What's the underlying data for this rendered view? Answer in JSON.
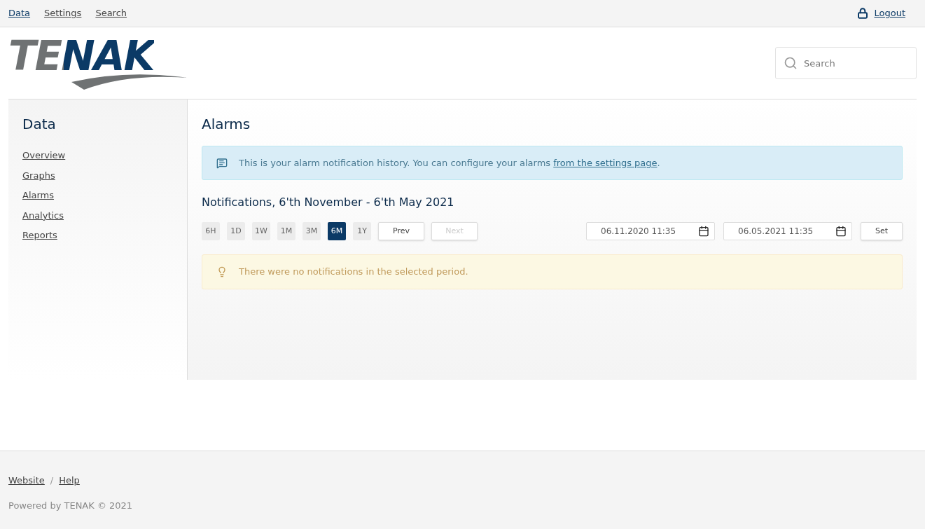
{
  "top_nav": {
    "links": [
      {
        "label": "Data",
        "selected": true
      },
      {
        "label": "Settings",
        "selected": false
      },
      {
        "label": "Search",
        "selected": false
      }
    ],
    "logout": "Logout"
  },
  "logo": {
    "text": "TENAK"
  },
  "search": {
    "placeholder": "Search"
  },
  "sidebar": {
    "title": "Data",
    "items": [
      "Overview",
      "Graphs",
      "Alarms",
      "Analytics",
      "Reports"
    ]
  },
  "main": {
    "title": "Alarms",
    "info": {
      "text": "This is your alarm notification history. You can configure your alarms ",
      "link": "from the settings page",
      "end": "."
    },
    "subtitle": "Notifications, 6'th November - 6'th May 2021",
    "ranges": [
      {
        "label": "6H",
        "selected": false
      },
      {
        "label": "1D",
        "selected": false
      },
      {
        "label": "1W",
        "selected": false
      },
      {
        "label": "1M",
        "selected": false
      },
      {
        "label": "3M",
        "selected": false
      },
      {
        "label": "6M",
        "selected": true
      },
      {
        "label": "1Y",
        "selected": false
      }
    ],
    "prev": {
      "label": "Prev",
      "disabled": false
    },
    "next": {
      "label": "Next",
      "disabled": true
    },
    "from": "06.11.2020 11:35",
    "to": "06.05.2021 11:35",
    "set": "Set",
    "warning": "There were no notifications in the selected period."
  },
  "footer": {
    "links": [
      "Website",
      "Help"
    ],
    "separator": "/",
    "powered": "Powered by TENAK © 2021"
  }
}
